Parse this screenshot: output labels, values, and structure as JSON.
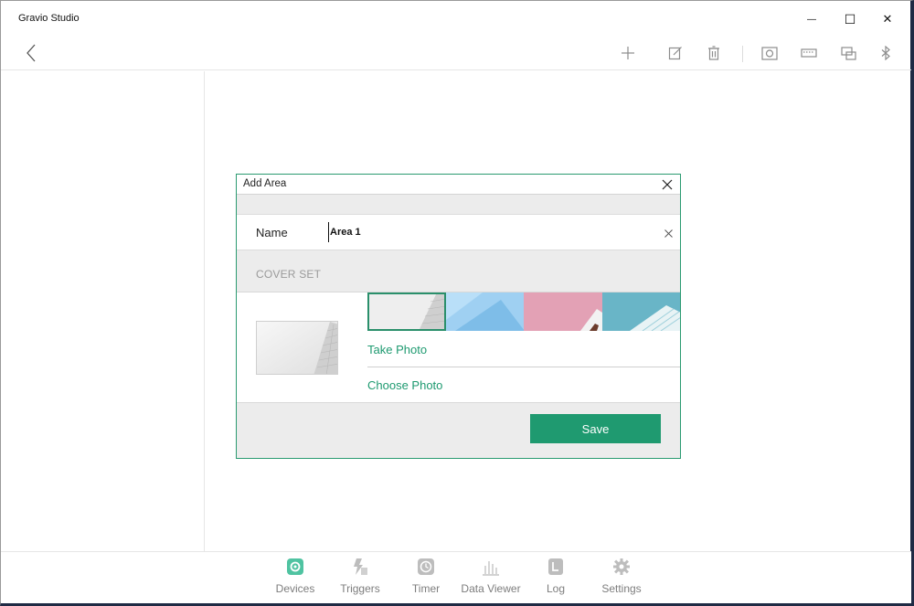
{
  "window": {
    "title": "Gravio Studio",
    "controls": {
      "minimize": "—",
      "maximize": "☐",
      "close": "✕"
    }
  },
  "toolbar": {
    "icons": [
      "back-icon",
      "add-icon",
      "edit-icon",
      "delete-icon",
      "camera-icon",
      "keyboard-icon",
      "device-icon",
      "bluetooth-icon"
    ]
  },
  "dialog": {
    "title": "Add Area",
    "name_label": "Name",
    "name_value": "Area 1",
    "cover_set_label": "COVER SET",
    "take_photo_label": "Take Photo",
    "choose_photo_label": "Choose Photo",
    "save_label": "Save"
  },
  "bottom_nav": {
    "items": [
      {
        "label": "Devices",
        "icon": "devices-icon"
      },
      {
        "label": "Triggers",
        "icon": "triggers-icon"
      },
      {
        "label": "Timer",
        "icon": "timer-icon"
      },
      {
        "label": "Data Viewer",
        "icon": "data-viewer-icon"
      },
      {
        "label": "Log",
        "icon": "log-icon"
      },
      {
        "label": "Settings",
        "icon": "settings-icon"
      }
    ]
  },
  "colors": {
    "accent": "#1f9a70",
    "nav_active": "#4fc3a1",
    "nav_inactive": "#bdbdbd",
    "dialog_border": "#2a9a70"
  }
}
